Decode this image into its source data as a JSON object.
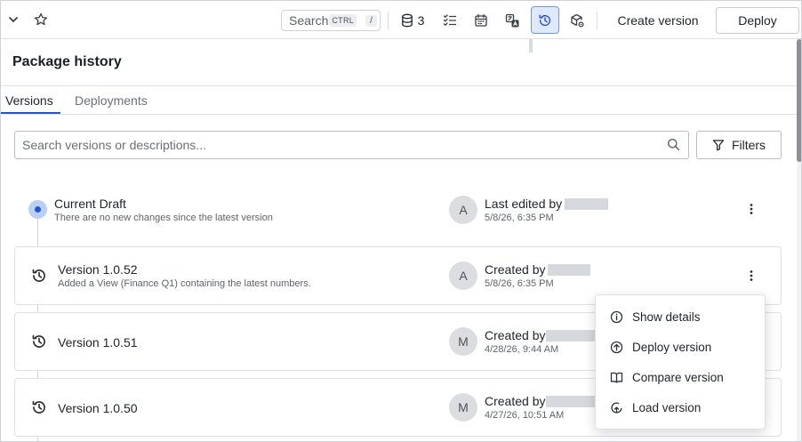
{
  "toolbar": {
    "search_label": "Search",
    "search_kbd": "CTRL",
    "search_kbd2": "/",
    "db_count": "3",
    "create_version_label": "Create version",
    "deploy_label": "Deploy"
  },
  "panel": {
    "title": "Package history",
    "tabs": [
      {
        "label": "Versions",
        "active": true
      },
      {
        "label": "Deployments",
        "active": false
      }
    ],
    "search_placeholder": "Search versions or descriptions...",
    "filters_label": "Filters"
  },
  "draft": {
    "title": "Current Draft",
    "description": "There are no new changes since the latest version",
    "avatar": "A",
    "meta_label": "Last edited by",
    "date": "5/8/26, 6:35 PM"
  },
  "versions": [
    {
      "title": "Version 1.0.52",
      "description": "Added a View (Finance Q1) containing the latest numbers.",
      "avatar": "A",
      "meta_label": "Created by",
      "date": "5/8/26, 6:35 PM"
    },
    {
      "title": "Version 1.0.51",
      "description": "",
      "avatar": "M",
      "meta_label": "Created by",
      "date": "4/28/26, 9:44 AM"
    },
    {
      "title": "Version 1.0.50",
      "description": "",
      "avatar": "M",
      "meta_label": "Created by",
      "date": "4/27/26, 10:51 AM"
    }
  ],
  "menu": {
    "items": [
      {
        "label": "Show details",
        "icon": "info-icon"
      },
      {
        "label": "Deploy version",
        "icon": "arrow-up-circle-icon"
      },
      {
        "label": "Compare version",
        "icon": "book-open-icon"
      },
      {
        "label": "Load version",
        "icon": "load-icon"
      }
    ]
  },
  "colors": {
    "accent": "#2457c5",
    "accent_soft": "#dfe9fb",
    "border": "#dde0e4",
    "avatar_bg": "#dcdde0"
  }
}
